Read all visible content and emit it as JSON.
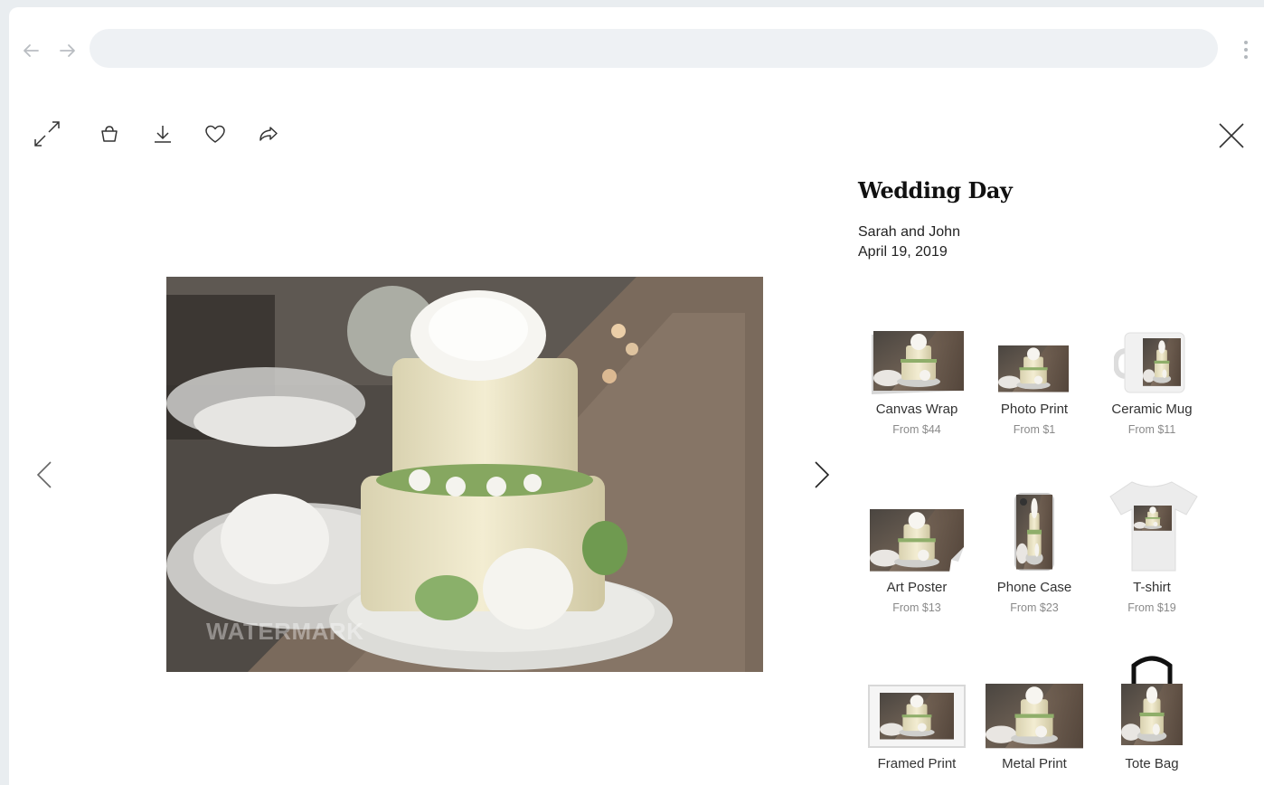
{
  "browser": {
    "address_value": "",
    "back_icon": "arrow-left-icon",
    "forward_icon": "arrow-right-icon",
    "menu_icon": "kebab-menu-icon"
  },
  "toolbar": {
    "icons": [
      "expand-icon",
      "shopping-bag-icon",
      "download-icon",
      "heart-icon",
      "share-icon"
    ],
    "close_icon": "close-icon"
  },
  "photo": {
    "subject": "wedding cake photo",
    "watermark": "WATERMARK"
  },
  "panel": {
    "title": "Wedding Day",
    "subtitle_line1": "Sarah and John",
    "subtitle_line2": "April 19, 2019"
  },
  "products": [
    {
      "name": "Canvas Wrap",
      "price": "From $44"
    },
    {
      "name": "Photo Print",
      "price": "From $1"
    },
    {
      "name": "Ceramic Mug",
      "price": "From $11"
    },
    {
      "name": "Art Poster",
      "price": "From $13"
    },
    {
      "name": "Phone Case",
      "price": "From $23"
    },
    {
      "name": "T-shirt",
      "price": "From $19"
    },
    {
      "name": "Framed Print",
      "price": ""
    },
    {
      "name": "Metal Print",
      "price": ""
    },
    {
      "name": "Tote Bag",
      "price": ""
    }
  ],
  "colors": {
    "background": "#e9edf0",
    "address_bar": "#eef1f4",
    "text": "#222222",
    "muted": "#8a8a8a"
  }
}
